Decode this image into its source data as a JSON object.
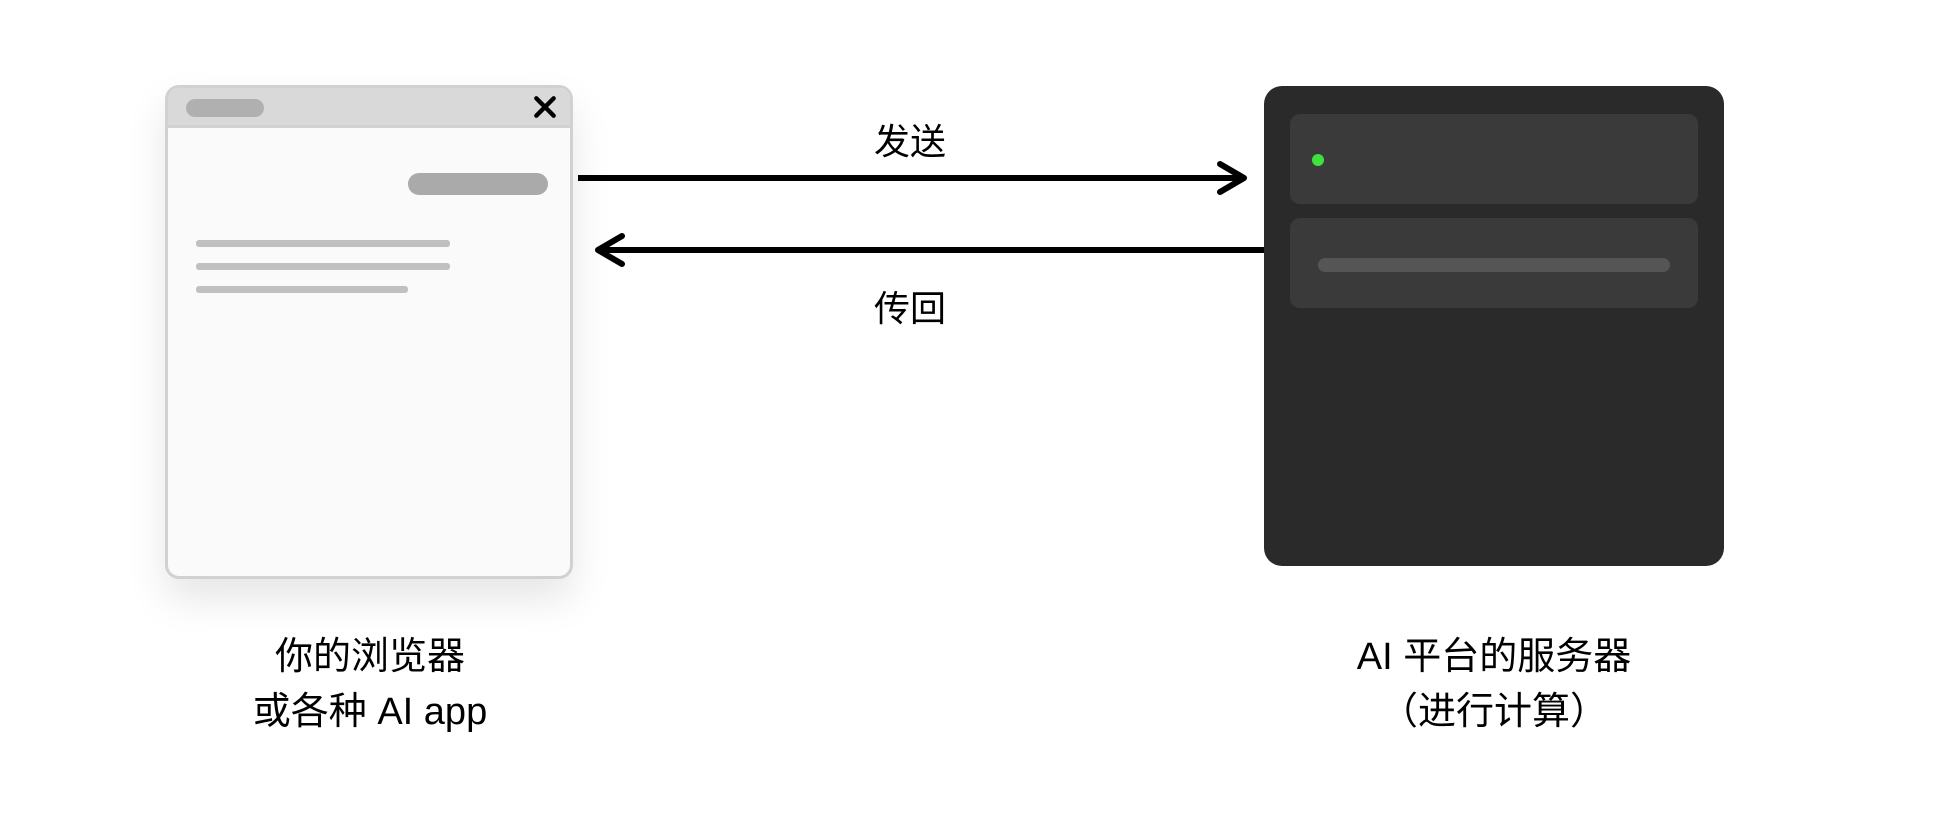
{
  "arrows": {
    "send_label": "发送",
    "return_label": "传回"
  },
  "client": {
    "caption_line1": "你的浏览器",
    "caption_line2": "或各种 AI app"
  },
  "server": {
    "caption_line1": "AI 平台的服务器",
    "caption_line2": "（进行计算）",
    "led_color": "#3ee23e"
  }
}
